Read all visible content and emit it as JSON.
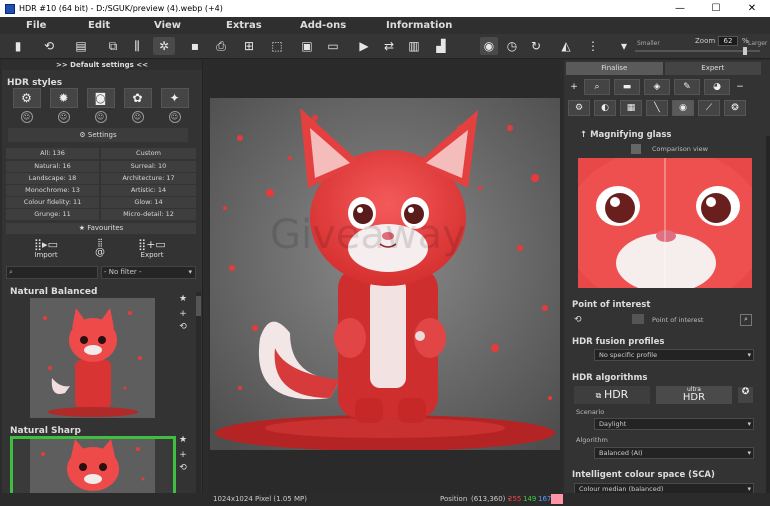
{
  "window": {
    "title": "HDR #10 (64 bit) - D:/SGUK/preview (4).webp (+4)",
    "controls": [
      "—",
      "☐",
      "✕"
    ]
  },
  "menu": [
    "File",
    "Edit",
    "View",
    "Extras",
    "Add-ons",
    "Information"
  ],
  "toolbar": {
    "zoom_label": "Zoom",
    "zoom_value": "62",
    "zoom_unit": "%",
    "smaller": "Smaller",
    "larger": "Larger"
  },
  "left": {
    "header": ">> Default settings <<",
    "hdr_styles_title": "HDR styles",
    "style_icons": [
      "gear-icon",
      "bug-icon",
      "camera-icon",
      "palette-icon",
      "sparkle-icon"
    ],
    "settings_label": "Settings",
    "categories": [
      [
        "All: 136",
        "Custom"
      ],
      [
        "Natural: 16",
        "Surreal: 10"
      ],
      [
        "Landscape: 18",
        "Architecture: 17"
      ],
      [
        "Monochrome: 13",
        "Artistic: 14"
      ],
      [
        "Colour fidelity: 11",
        "Glow: 14"
      ],
      [
        "Grunge: 11",
        "Micro-detail: 12"
      ]
    ],
    "favourites": "Favourites",
    "import": "Import",
    "export": "Export",
    "filter": "- No filter -",
    "presets": [
      "Natural Balanced",
      "Natural Sharp"
    ]
  },
  "status": {
    "dimensions": "1024x1024 Pixel (1.05 MP)",
    "position_label": "Position",
    "position": "(613,360) -",
    "r": "255",
    "g": "149",
    "b": "167",
    "r_color": "#ff4040",
    "g_color": "#40d040",
    "b_color": "#5a9aff",
    "swatch_color": "#ff95a7"
  },
  "right": {
    "tabs": [
      "Finalise",
      "Expert"
    ],
    "magnifying_glass": "Magnifying glass",
    "comparison_view": "Comparison view",
    "point_of_interest_title": "Point of interest",
    "point_of_interest_btn": "Point of interest",
    "fusion_title": "HDR fusion profiles",
    "fusion_value": "No specific profile",
    "algorithms_title": "HDR algorithms",
    "hdr_btn": "HDR",
    "ultra_top": "ultra",
    "ultra_bottom": "HDR",
    "scenario_label": "Scenario",
    "scenario_value": "Daylight",
    "algorithm_label": "Algorithm",
    "algorithm_value": "Balanced (AI)",
    "sca_title": "Intelligent colour space (SCA)",
    "sca_value": "Colour median (balanced)"
  }
}
